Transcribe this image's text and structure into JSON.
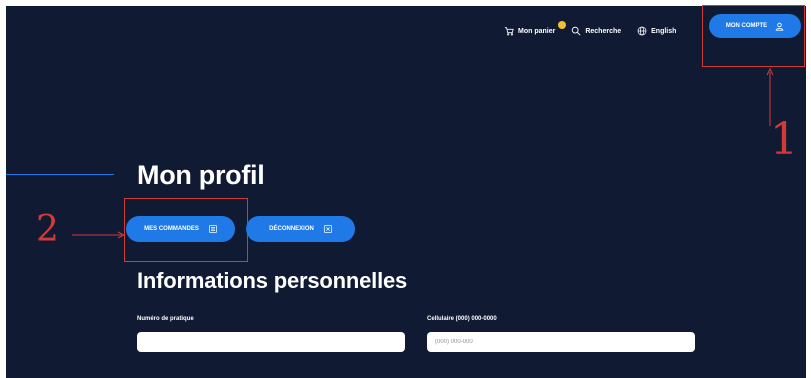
{
  "topnav": {
    "cart_label": "Mon panier",
    "search_label": "Recherche",
    "language_label": "English"
  },
  "account_button": {
    "label": "MON COMPTE"
  },
  "page_title": "Mon profil",
  "actions": {
    "orders_label": "MES COMMANDES",
    "logout_label": "DÉCONNEXION"
  },
  "section_title": "Informations personnelles",
  "fields": {
    "practice_number": {
      "label": "Numéro de pratique",
      "value": "",
      "placeholder": ""
    },
    "cellphone": {
      "label": "Cellulaire (000) 000-0000",
      "value": "",
      "placeholder": "(000) 000-000"
    }
  },
  "annotations": {
    "marker_1": "1",
    "marker_2": "2",
    "color": "#d23a3a"
  },
  "colors": {
    "background": "#111a33",
    "accent": "#1f7ae8",
    "cart_badge": "#f2c02e"
  },
  "icons": [
    "cart-icon",
    "search-icon",
    "globe-icon",
    "user-icon",
    "list-icon",
    "close-box-icon"
  ]
}
